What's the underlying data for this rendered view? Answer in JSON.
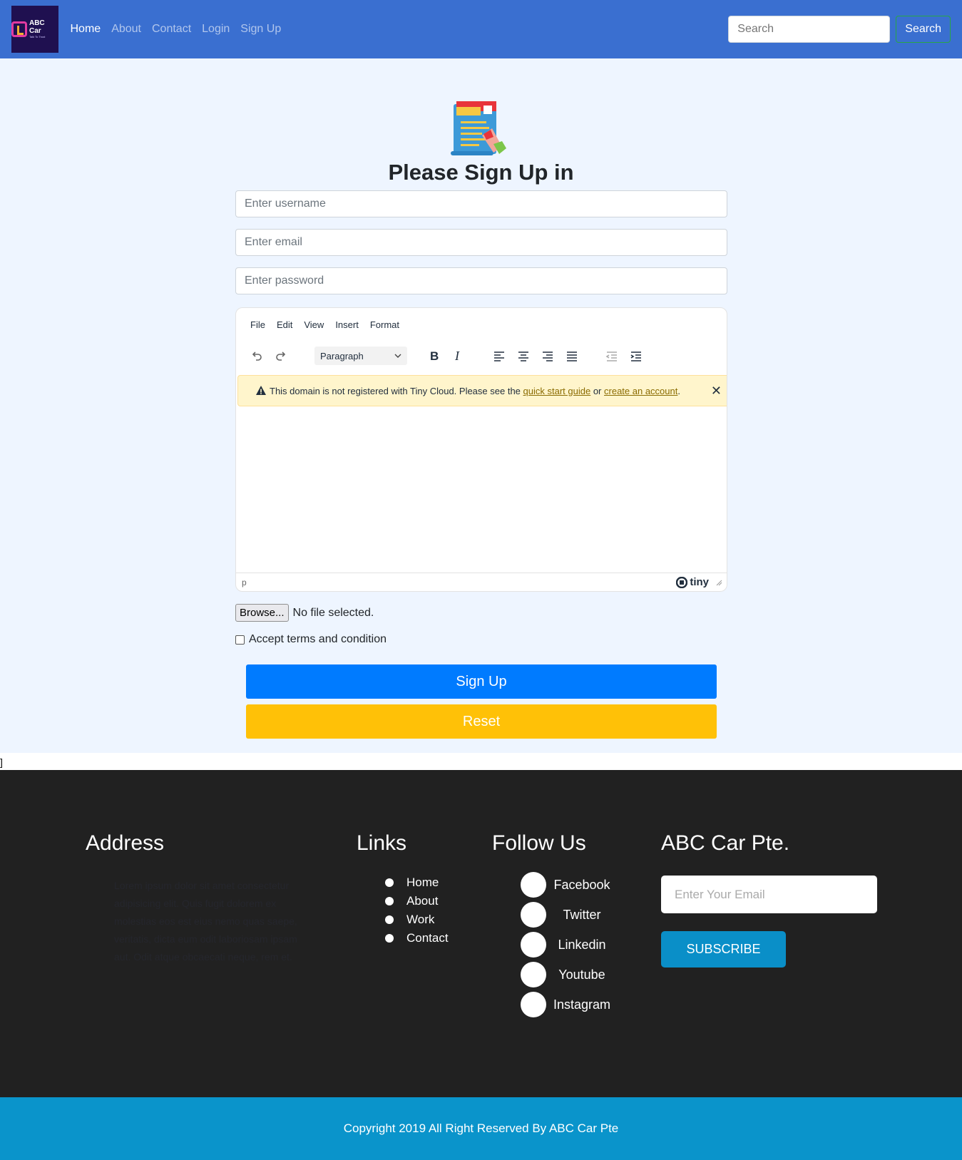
{
  "navbar": {
    "logo_title": "ABC Car",
    "logo_tagline": "Talk To Trust",
    "links": [
      "Home",
      "About",
      "Contact",
      "Login",
      "Sign Up"
    ],
    "search_placeholder": "Search",
    "search_button": "Search"
  },
  "form": {
    "title": "Please Sign Up in",
    "username_placeholder": "Enter username",
    "email_placeholder": "Enter email",
    "password_placeholder": "Enter password",
    "editor": {
      "menu": [
        "File",
        "Edit",
        "View",
        "Insert",
        "Format"
      ],
      "block_format": "Paragraph",
      "warning_prefix": "This domain is not registered with Tiny Cloud. Please see the",
      "warning_link1": "quick start guide",
      "warning_or": "or",
      "warning_link2": "create an account",
      "warning_end": ".",
      "status_path": "p",
      "brand": "tiny"
    },
    "browse_label": "Browse...",
    "file_status": "No file selected.",
    "terms_label": "Accept terms and condition",
    "signup_button": "Sign Up",
    "reset_button": "Reset"
  },
  "stray_char": "]",
  "footer": {
    "address_heading": "Address",
    "address_text": "Lorem ipsum dolor sit amet consectetur adipisicing elit. Quis fugit dolorem ex molestias eos est eius nemo quas saepe, veritatis, dicta eum odit laboriosam ipsam aut. Odit atque obcaecati neque, rem et.",
    "links_heading": "Links",
    "links": [
      "Home",
      "About",
      "Work",
      "Contact"
    ],
    "follow_heading": "Follow Us",
    "social": [
      "Facebook",
      "Twitter",
      "Linkedin",
      "Youtube",
      "Instagram"
    ],
    "company_heading": "ABC Car Pte.",
    "email_placeholder": "Enter Your Email",
    "subscribe_button": "SUBSCRIBE"
  },
  "copyright": "Copyright 2019 All Right Reserved By ABC Car Pte",
  "colors": {
    "navbar": "#3a6fd0",
    "page_bg": "#eef5ff",
    "primary": "#007bff",
    "warning": "#ffc107",
    "footer": "#212121",
    "copyright_bar": "#0a94cb"
  }
}
